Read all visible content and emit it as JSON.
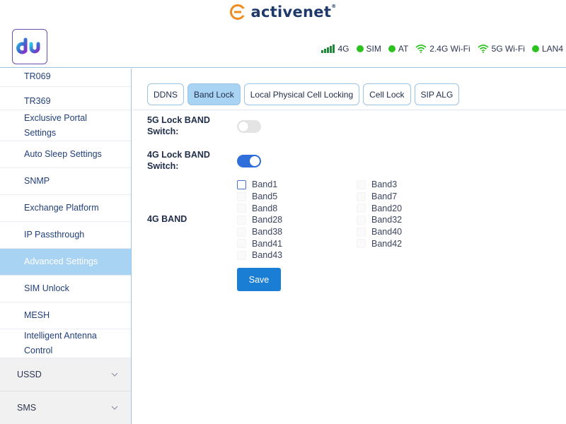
{
  "banner": {
    "brand_text": "activenet",
    "trademark": "®"
  },
  "header": {
    "logo": "du",
    "status": [
      {
        "label": "4G",
        "icon": "signal-icon"
      },
      {
        "label": "SIM",
        "icon": "status-dot"
      },
      {
        "label": "AT",
        "icon": "status-dot"
      },
      {
        "label": "2.4G Wi-Fi",
        "icon": "wifi-icon"
      },
      {
        "label": "5G Wi-Fi",
        "icon": "wifi-icon"
      },
      {
        "label": "LAN4",
        "icon": "status-dot"
      }
    ],
    "status_color": "#2bc21e"
  },
  "sidebar": {
    "items": [
      {
        "label": "TR069"
      },
      {
        "label": "TR369"
      },
      {
        "label": "Exclusive Portal Settings"
      },
      {
        "label": "Auto Sleep Settings"
      },
      {
        "label": "SNMP"
      },
      {
        "label": "Exchange Platform"
      },
      {
        "label": "IP Passthrough"
      },
      {
        "label": "Advanced Settings",
        "active": true
      },
      {
        "label": "SIM Unlock"
      },
      {
        "label": "MESH"
      },
      {
        "label": "Intelligent Antenna Control"
      }
    ],
    "groups": [
      {
        "label": "USSD"
      },
      {
        "label": "SMS"
      }
    ]
  },
  "tabs": [
    {
      "label": "DDNS"
    },
    {
      "label": "Band Lock",
      "active": true
    },
    {
      "label": "Local Physical Cell Locking"
    },
    {
      "label": "Cell Lock"
    },
    {
      "label": "SIP ALG"
    }
  ],
  "form": {
    "lock5g_label": "5G Lock BAND Switch:",
    "lock5g_on": false,
    "lock4g_label": "4G Lock BAND Switch:",
    "lock4g_on": true,
    "band_label": "4G BAND",
    "bands_left": [
      "Band1",
      "Band5",
      "Band8",
      "Band28",
      "Band38",
      "Band41",
      "Band43"
    ],
    "bands_right": [
      "Band3",
      "Band7",
      "Band20",
      "Band32",
      "Band40",
      "Band42"
    ],
    "save_label": "Save"
  },
  "colors": {
    "accent": "#1a7fd4",
    "toggle_on": "#2f6fdc",
    "active_bg": "#a9d3f2",
    "border": "#9cc4e4"
  }
}
